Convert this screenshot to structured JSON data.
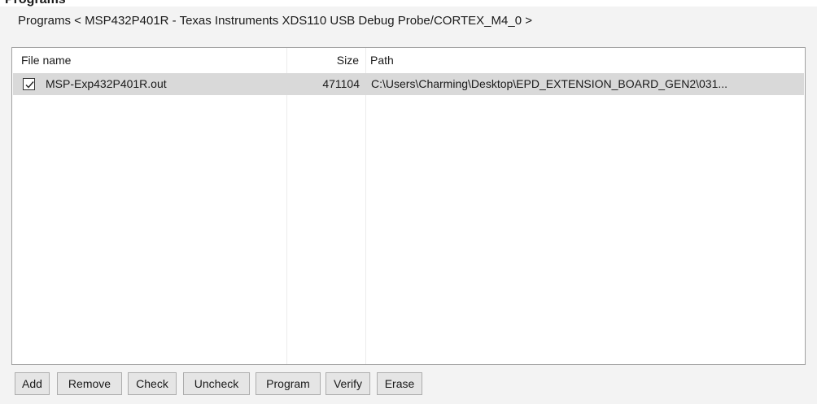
{
  "window": {
    "title": "Programs < MSP432P401R - Texas Instruments XDS110 USB Debug Probe/CORTEX_M4_0 >",
    "clipped_heading": "Programs"
  },
  "table": {
    "columns": [
      "File name",
      "Size",
      "Path"
    ],
    "rows": [
      {
        "checked": true,
        "file_name": "MSP-Exp432P401R.out",
        "size": "471104",
        "path": "C:\\Users\\Charming\\Desktop\\EPD_EXTENSION_BOARD_GEN2\\031..."
      }
    ]
  },
  "toolbar": {
    "add": "Add",
    "remove": "Remove",
    "check": "Check",
    "uncheck": "Uncheck",
    "program": "Program",
    "verify": "Verify",
    "erase": "Erase"
  },
  "colors": {
    "panel_bg": "#f3f3f3",
    "selected_row": "#d9d9d9",
    "button_bg": "#e5e5e5",
    "border": "#a0a0a0"
  },
  "icons": [
    "checkmark-icon"
  ]
}
